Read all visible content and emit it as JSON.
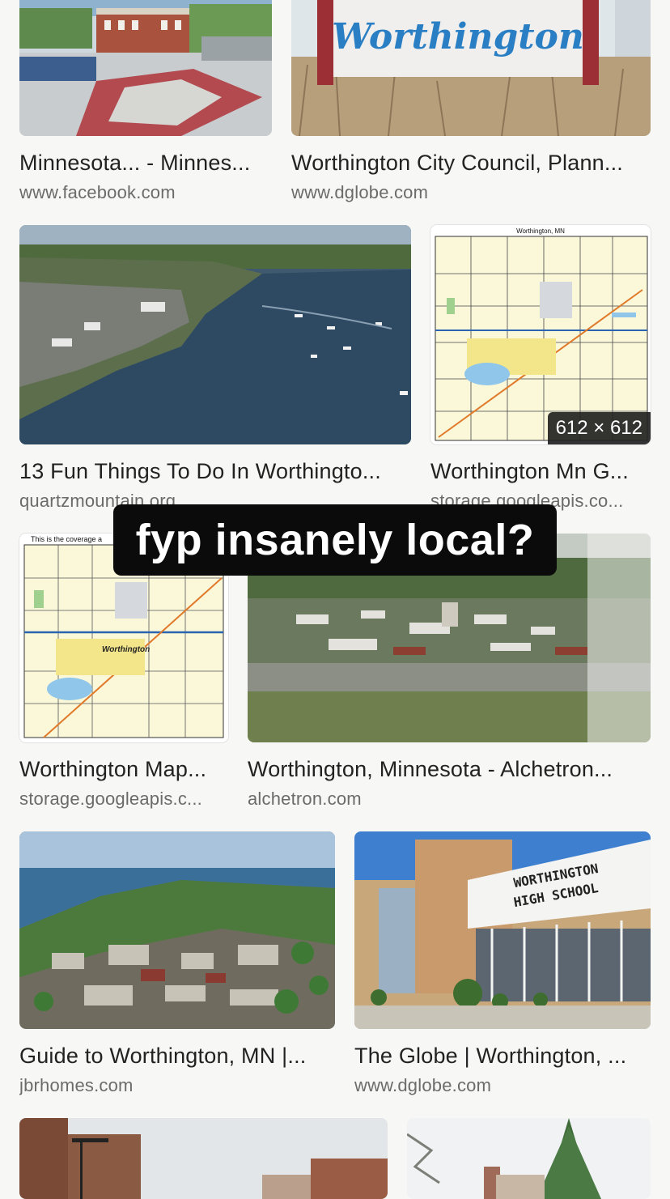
{
  "overlay": {
    "caption": "fyp insanely local?"
  },
  "results": [
    {
      "title": "Minnesota... - Minnes...",
      "source": "www.facebook.com"
    },
    {
      "title": "Worthington City Council, Plann...",
      "source": "www.dglobe.com",
      "sign_text": "Worthington"
    },
    {
      "title": "13 Fun Things To Do In Worthingto...",
      "source": "quartzmountain.org"
    },
    {
      "title": "Worthington Mn G...",
      "source": "storage.googleapis.co...",
      "map_title": "Worthington, MN",
      "dimensions": "612 × 612"
    },
    {
      "title": "Worthington Map...",
      "source": "storage.googleapis.c...",
      "map_header": "This is the coverage a",
      "map_label": "Worthington"
    },
    {
      "title": "Worthington, Minnesota - Alchetron...",
      "source": "alchetron.com"
    },
    {
      "title": "Guide to Worthington, MN |...",
      "source": "jbrhomes.com"
    },
    {
      "title": "The Globe | Worthington, ...",
      "source": "www.dglobe.com",
      "sign_line1": "WORTHINGTON",
      "sign_line2": "HIGH SCHOOL"
    },
    {
      "title": "",
      "source": ""
    },
    {
      "title": "",
      "source": ""
    }
  ]
}
